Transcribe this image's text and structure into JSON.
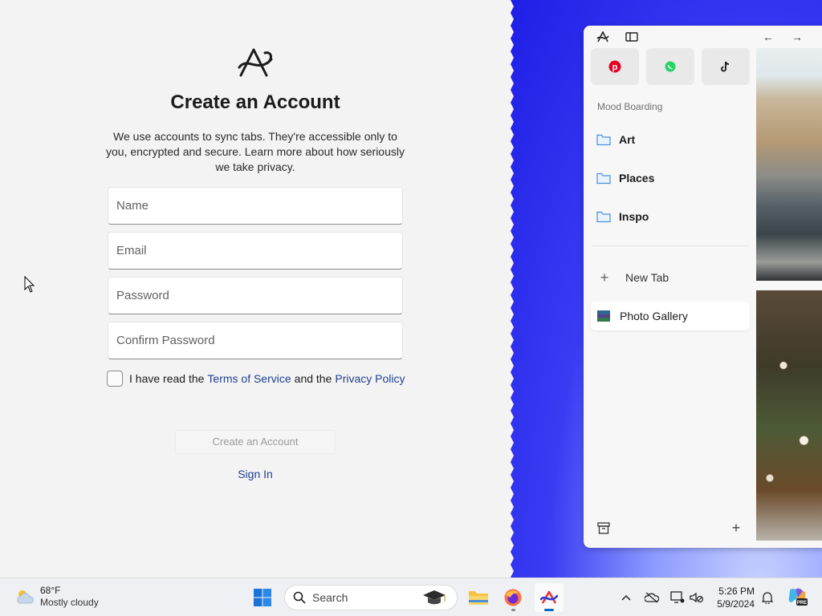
{
  "signup": {
    "title": "Create an Account",
    "description": "We use accounts to sync tabs. They're accessible only to you, encrypted and secure. Learn more about how seriously we take privacy.",
    "fields": {
      "name_placeholder": "Name",
      "email_placeholder": "Email",
      "password_placeholder": "Password",
      "confirm_placeholder": "Confirm Password"
    },
    "agree": {
      "prefix": "I have read the",
      "terms": "Terms of Service",
      "middle": "and the",
      "privacy": "Privacy Policy"
    },
    "create_button": "Create an Account",
    "sign_in": "Sign In"
  },
  "browser": {
    "favorites": [
      "pinterest-icon",
      "whatsapp-icon",
      "tiktok-icon"
    ],
    "section_label": "Mood Boarding",
    "folders": [
      "Art",
      "Places",
      "Inspo"
    ],
    "new_tab": "New Tab",
    "active_tab": "Photo Gallery"
  },
  "taskbar": {
    "weather_temp": "68°F",
    "weather_condition": "Mostly cloudy",
    "search_label": "Search",
    "time": "5:26 PM",
    "date": "5/9/2024",
    "copilot_badge": "PRE"
  },
  "colors": {
    "link": "#1f3f8f",
    "accent_blue": "#1f1ee6",
    "pinterest": "#e60023",
    "whatsapp": "#25d366",
    "folder": "#4a90d9"
  }
}
